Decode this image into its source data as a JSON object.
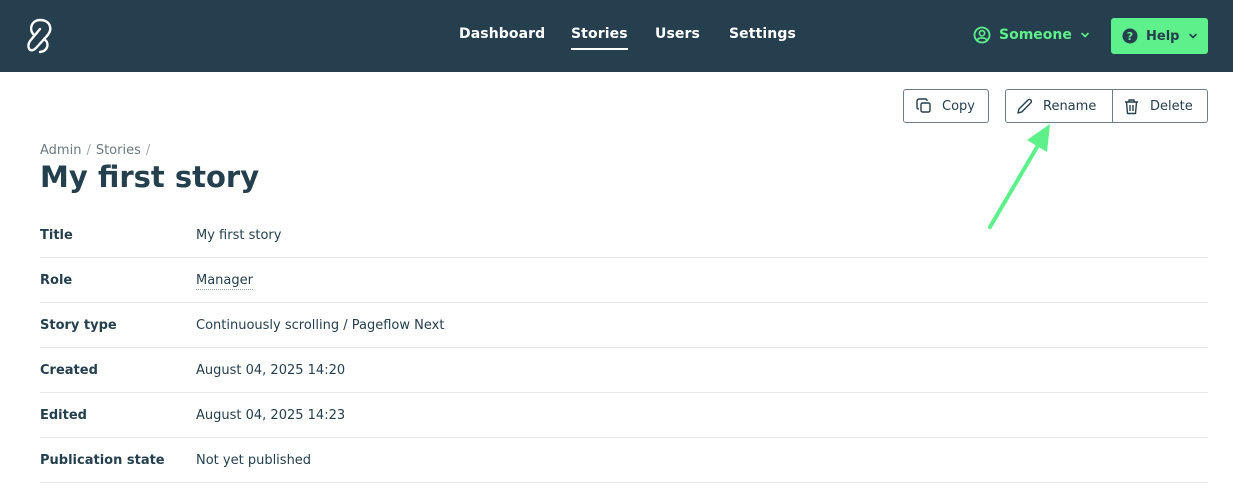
{
  "header": {
    "nav": [
      {
        "label": "Dashboard"
      },
      {
        "label": "Stories"
      },
      {
        "label": "Users"
      },
      {
        "label": "Settings"
      }
    ],
    "user": {
      "label": "Someone"
    },
    "help": {
      "label": "Help"
    }
  },
  "actions": {
    "copy": "Copy",
    "rename": "Rename",
    "delete": "Delete"
  },
  "breadcrumb": [
    "Admin",
    "Stories"
  ],
  "page_title": "My first story",
  "details": [
    {
      "key": "Title",
      "value": "My first story"
    },
    {
      "key": "Role",
      "value": "Manager"
    },
    {
      "key": "Story type",
      "value": "Continuously scrolling / Pageflow Next"
    },
    {
      "key": "Created",
      "value": "August 04, 2025 14:20"
    },
    {
      "key": "Edited",
      "value": "August 04, 2025 14:23"
    },
    {
      "key": "Publication state",
      "value": "Not yet published"
    }
  ],
  "colors": {
    "header_bg": "#263f4f",
    "accent_green": "#5ef08a",
    "text_dark": "#243f4d"
  },
  "icons": [
    "logo-icon",
    "user-circle-icon",
    "chevron-down-icon",
    "question-icon",
    "copy-icon",
    "pencil-icon",
    "trash-icon"
  ]
}
